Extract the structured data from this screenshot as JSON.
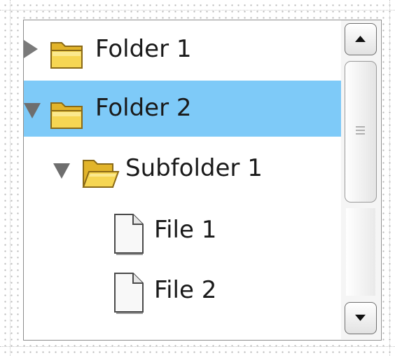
{
  "tree": {
    "nodes": [
      {
        "label": "Folder 1",
        "icon": "folder-closed-icon",
        "expander": "collapsed",
        "selected": false
      },
      {
        "label": "Folder 2",
        "icon": "folder-closed-icon",
        "expander": "expanded",
        "selected": true
      },
      {
        "label": "Subfolder 1",
        "icon": "folder-open-icon",
        "expander": "expanded",
        "selected": false
      },
      {
        "label": "File 1",
        "icon": "file-icon",
        "expander": "none",
        "selected": false
      },
      {
        "label": "File 2",
        "icon": "file-icon",
        "expander": "none",
        "selected": false
      }
    ]
  },
  "scrollbar": {
    "up_icon": "arrow-up-icon",
    "down_icon": "arrow-down-icon",
    "grip_icon": "grip-icon"
  },
  "colors": {
    "selection": "#7ecaf8",
    "folder": "#f4cf3a",
    "panel_border": "#8c8c8c"
  }
}
